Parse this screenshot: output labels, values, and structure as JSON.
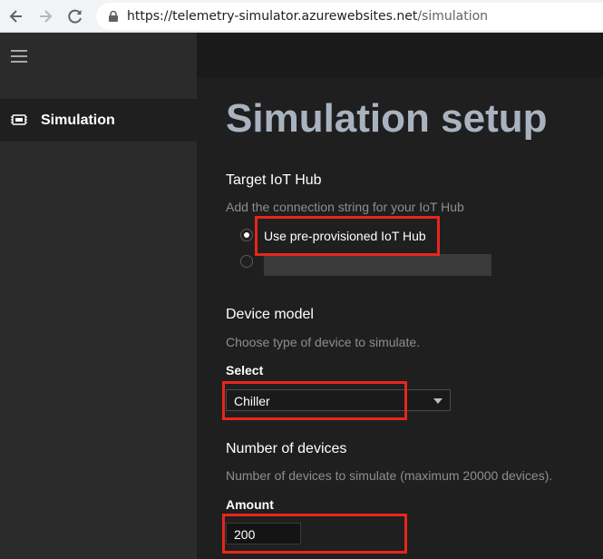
{
  "browser": {
    "url_host": "https://telemetry-simulator.azurewebsites.net",
    "url_path": "/simulation"
  },
  "sidebar": {
    "items": [
      {
        "label": "Simulation",
        "icon": "chip-icon"
      }
    ]
  },
  "page": {
    "title": "Simulation setup"
  },
  "iot_hub": {
    "heading": "Target IoT Hub",
    "description": "Add the connection string for your IoT Hub",
    "option_preprovisioned": "Use pre-provisioned IoT Hub",
    "connection_string_value": ""
  },
  "device_model": {
    "heading": "Device model",
    "description": "Choose type of device to simulate.",
    "select_label": "Select",
    "selected_value": "Chiller"
  },
  "devices": {
    "heading": "Number of devices",
    "description": "Number of devices to simulate (maximum 20000 devices).",
    "amount_label": "Amount",
    "amount_value": "200"
  },
  "colors": {
    "highlight": "#e8261c",
    "title": "#a9b3c0",
    "background": "#1f1f1f",
    "sidebar": "#2b2b2b"
  }
}
